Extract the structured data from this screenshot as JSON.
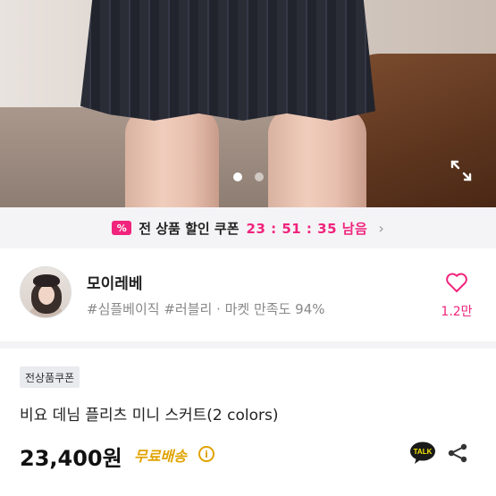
{
  "gallery": {
    "pages": 2,
    "active_index": 0,
    "expand_icon": "expand-icon"
  },
  "coupon_bar": {
    "icon_label": "%",
    "text": "전 상품 할인 쿠폰",
    "timer": "23 : 51 : 35 남음",
    "chevron": "›",
    "colors": {
      "accent": "#f0247d"
    }
  },
  "shop": {
    "name": "모이레베",
    "tags": "#심플베이직 #러블리 · 마켓 만족도 94%",
    "like_count": "1.2만",
    "like_icon": "heart-icon"
  },
  "product": {
    "badge": "전상품쿠폰",
    "title": "비요 데님 플리츠 미니 스커트(2 colors)",
    "price": "23,400원",
    "shipping": "무료배송",
    "info_icon": "i",
    "talk_label": "TALK",
    "share_icon": "share-icon",
    "colors": {
      "shipping": "#e0a300"
    }
  }
}
